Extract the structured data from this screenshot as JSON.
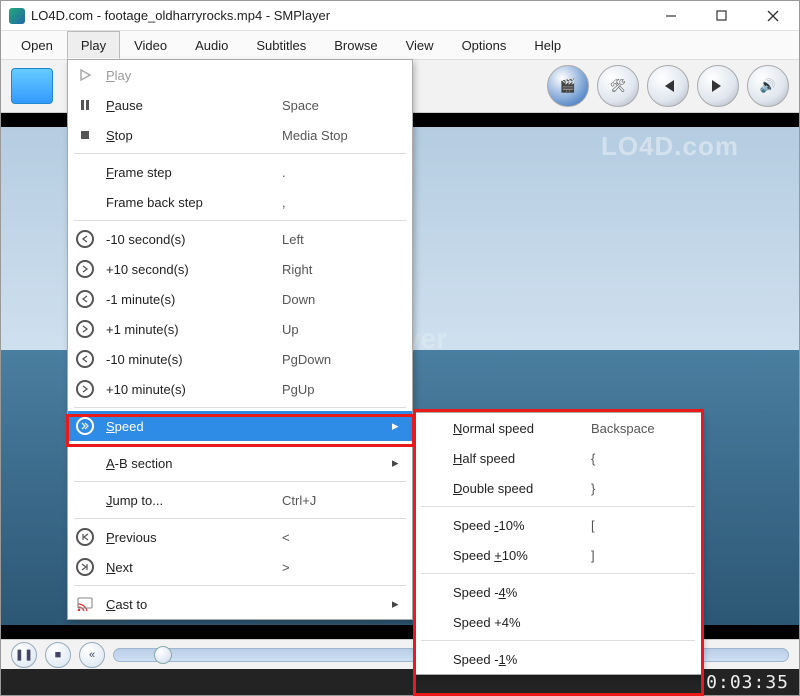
{
  "title": "LO4D.com - footage_oldharryrocks.mp4 - SMPlayer",
  "menubar": [
    "Open",
    "Play",
    "Video",
    "Audio",
    "Subtitles",
    "Browse",
    "View",
    "Options",
    "Help"
  ],
  "toolbar": {
    "buttons": [
      "folder",
      "clapper",
      "tools",
      "prev",
      "next",
      "speaker"
    ]
  },
  "watermarks": {
    "site": "LO4D.com",
    "player": "SMPlayer"
  },
  "status_time": "0:03:35",
  "play_menu": [
    {
      "icon": "play",
      "label": "Play",
      "shortcut": "",
      "sub": false,
      "disabled": true,
      "u": 0
    },
    {
      "icon": "pause",
      "label": "Pause",
      "shortcut": "Space",
      "sub": false,
      "u": 0
    },
    {
      "icon": "stop",
      "label": "Stop",
      "shortcut": "Media Stop",
      "sub": false,
      "u": 0
    },
    {
      "sep": true
    },
    {
      "icon": "",
      "label": "Frame step",
      "shortcut": ".",
      "sub": false,
      "u": 0
    },
    {
      "icon": "",
      "label": "Frame back step",
      "shortcut": ",",
      "sub": false,
      "u": -1
    },
    {
      "sep": true
    },
    {
      "icon": "rew",
      "label": "-10 second(s)",
      "shortcut": "Left",
      "sub": false,
      "u": -1
    },
    {
      "icon": "ff",
      "label": "+10 second(s)",
      "shortcut": "Right",
      "sub": false,
      "u": -1
    },
    {
      "icon": "rew",
      "label": "-1 minute(s)",
      "shortcut": "Down",
      "sub": false,
      "u": -1
    },
    {
      "icon": "ff",
      "label": "+1 minute(s)",
      "shortcut": "Up",
      "sub": false,
      "u": -1
    },
    {
      "icon": "rew",
      "label": "-10 minute(s)",
      "shortcut": "PgDown",
      "sub": false,
      "u": -1
    },
    {
      "icon": "ff",
      "label": "+10 minute(s)",
      "shortcut": "PgUp",
      "sub": false,
      "u": -1
    },
    {
      "sep": true
    },
    {
      "icon": "speed",
      "label": "Speed",
      "shortcut": "",
      "sub": true,
      "highlight": true,
      "u": 0
    },
    {
      "sep": true
    },
    {
      "icon": "",
      "label": "A-B section",
      "shortcut": "",
      "sub": true,
      "u": 0
    },
    {
      "sep": true
    },
    {
      "icon": "",
      "label": "Jump to...",
      "shortcut": "Ctrl+J",
      "sub": false,
      "u": 0
    },
    {
      "sep": true
    },
    {
      "icon": "prev",
      "label": "Previous",
      "shortcut": "<",
      "sub": false,
      "u": 0
    },
    {
      "icon": "next",
      "label": "Next",
      "shortcut": ">",
      "sub": false,
      "u": 0
    },
    {
      "sep": true
    },
    {
      "icon": "cast",
      "label": "Cast to",
      "shortcut": "",
      "sub": true,
      "u": 0
    }
  ],
  "speed_menu": [
    {
      "label": "Normal speed",
      "shortcut": "Backspace",
      "u": 0
    },
    {
      "label": "Half speed",
      "shortcut": "{",
      "u": 0
    },
    {
      "label": "Double speed",
      "shortcut": "}",
      "u": 0
    },
    {
      "sep": true
    },
    {
      "label": "Speed -10%",
      "shortcut": "[",
      "u": 6
    },
    {
      "label": "Speed +10%",
      "shortcut": "]",
      "u": 6
    },
    {
      "sep": true
    },
    {
      "label": "Speed -4%",
      "shortcut": "",
      "u": 7
    },
    {
      "label": "Speed +4%",
      "shortcut": "",
      "u": -1
    },
    {
      "sep": true
    },
    {
      "label": "Speed -1%",
      "shortcut": "",
      "u": 7
    }
  ]
}
